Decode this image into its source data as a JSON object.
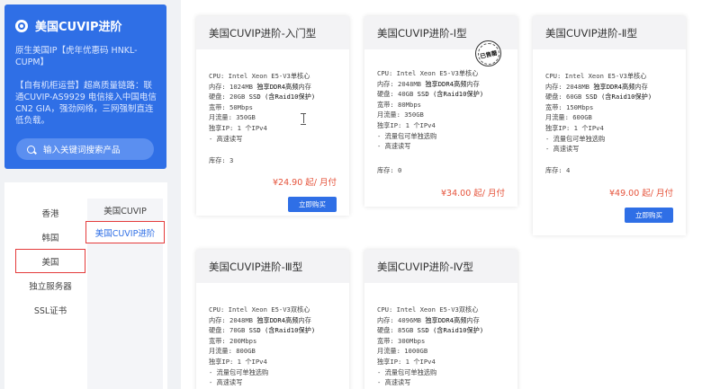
{
  "promo": {
    "title": "美国CUVIP进阶",
    "desc": "原生美国IP【虎年优惠码 HNKL-CUPM】",
    "desc2": "【自有机柜运营】超高质量链路：联通CUVIP-AS9929 电信接入中国电信CN2 GIA，强劲网络，三网强制直连低负载。",
    "search_label": "输入关键词搜索产品"
  },
  "nav": {
    "regions": [
      "香港",
      "韩国",
      "美国",
      "独立服务器",
      "SSL证书"
    ],
    "active_region": 2,
    "categories": [
      "美国CUVIP",
      "美国CUVIP进阶"
    ],
    "active_category": 1
  },
  "cards": [
    {
      "name": "美国CUVIP进阶-入门型",
      "cpu": "CPU: Intel Xeon E5-V3单核心",
      "ram_prefix": "内存: 1024MB ",
      "ram_bold": "独享DDR4高频",
      "ram_suffix": "内存",
      "disk_prefix": "硬盘: 20GB ",
      "disk_bold": "SSD (含Raid10保护)",
      "bandwidth": "宽带: 50Mbps",
      "traffic": "月流量: 350GB",
      "ip": "独享IP: 1 个IPv4",
      "feat1": "- 高速读写",
      "feat2": "",
      "stock": "库存:  3",
      "price": "¥24.90 起/ 月付",
      "buy": "立即购买",
      "sold_out": false
    },
    {
      "name": "美国CUVIP进阶-Ⅰ型",
      "cpu": "CPU: Intel Xeon E5-V3单核心",
      "ram_prefix": "内存: 2048MB ",
      "ram_bold": "独享DDR4高频",
      "ram_suffix": "内存",
      "disk_prefix": "硬盘: 40GB ",
      "disk_bold": "SSD (含Raid10保护)",
      "bandwidth": "宽带: 80Mbps",
      "traffic": "月流量: 350GB",
      "ip": "独享IP: 1 个IPv4",
      "feat1": "- 流量包可单独选购",
      "feat2": "- 高速读写",
      "stock": "库存:  0",
      "price": "¥34.00 起/ 月付",
      "buy": "",
      "sold_out": true,
      "sold_label": "已售罄"
    },
    {
      "name": "美国CUVIP进阶-Ⅱ型",
      "cpu": "CPU: Intel Xeon E5-V3单核心",
      "ram_prefix": "内存: 2048MB ",
      "ram_bold": "独享DDR4高频",
      "ram_suffix": "内存",
      "disk_prefix": "硬盘: 60GB ",
      "disk_bold": "SSD (含Raid10保护)",
      "bandwidth": "宽带: 150Mbps",
      "traffic": "月流量: 600GB",
      "ip": "独享IP: 1 个IPv4",
      "feat1": "- 流量包可单独选购",
      "feat2": "- 高速读写",
      "stock": "库存:  4",
      "price": "¥49.00 起/ 月付",
      "buy": "立即购买",
      "sold_out": false
    },
    {
      "name": "美国CUVIP进阶-Ⅲ型",
      "cpu": "CPU: Intel Xeon E5-V3双核心",
      "ram_prefix": "内存: 2048MB ",
      "ram_bold": "独享DDR4高频",
      "ram_suffix": "内存",
      "disk_prefix": "硬盘: 70GB ",
      "disk_bold": "SSD (含Raid10保护)",
      "bandwidth": "宽带: 200Mbps",
      "traffic": "月流量: 800GB",
      "ip": "独享IP: 1 个IPv4",
      "feat1": "- 流量包可单独选购",
      "feat2": "- 高速读写"
    },
    {
      "name": "美国CUVIP进阶-Ⅳ型",
      "cpu": "CPU: Intel Xeon E5-V3双核心",
      "ram_prefix": "内存: 4096MB ",
      "ram_bold": "独享DDR4高频",
      "ram_suffix": "内存",
      "disk_prefix": "硬盘: 85GB ",
      "disk_bold": "SSD (含Raid10保护)",
      "bandwidth": "宽带: 300Mbps",
      "traffic": "月流量: 1000GB",
      "ip": "独享IP: 1 个IPv4",
      "feat1": "- 流量包可单独选购",
      "feat2": "- 高速读写"
    }
  ],
  "colors": {
    "brand_blue": "#2f6fe6",
    "price_red": "#e5533b",
    "active_border": "#e43b3b"
  }
}
